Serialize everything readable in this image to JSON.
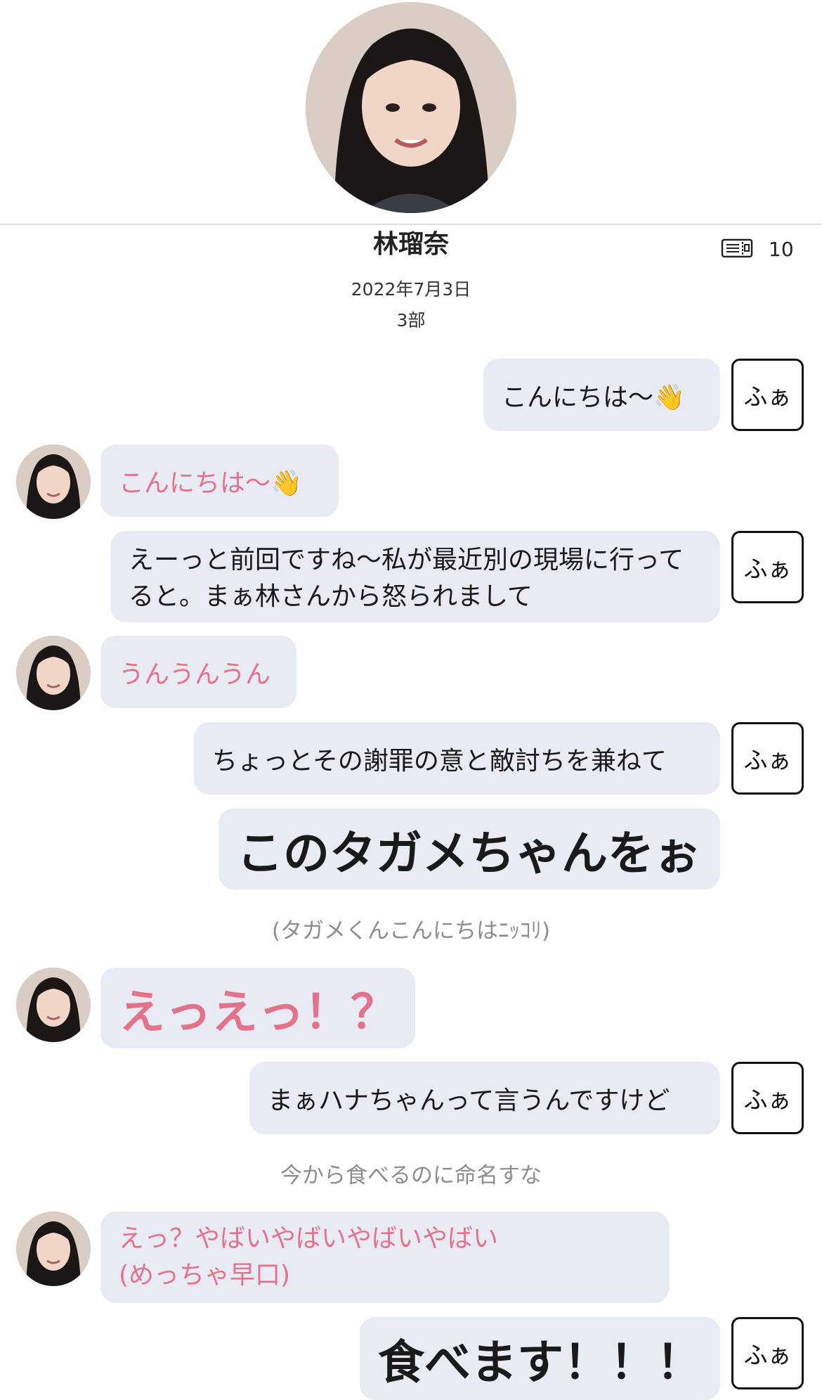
{
  "header": {
    "name": "林瑠奈",
    "date": "2022年7月3日",
    "part": "3部",
    "count": "10"
  },
  "messages": {
    "m1": "こんにちは〜👋",
    "m2": "こんにちは〜👋",
    "m3": "えーっと前回ですね〜私が最近別の現場に行ってると。まぁ林さんから怒られまして",
    "m4": "うんうんうん",
    "m5": "ちょっとその謝罪の意と敵討ちを兼ねて",
    "m6": "このタガメちゃんをぉ",
    "note1": "(タガメくんこんにちはﾆｯｺﾘ)",
    "m7": "えっえっ！？",
    "m8": "まぁハナちゃんって言うんですけど",
    "note2": "今から食べるのに命名すな",
    "m9_line1": "えっ？やばいやばいやばいやばい",
    "m9_line2": "(めっちゃ早口)",
    "m10": "食べます！！！"
  },
  "fua_label": "ふぁ",
  "colors": {
    "bubble_bg": "#e9ebf4",
    "member_text": "#e3738a",
    "note_text": "#8d8d8d"
  }
}
